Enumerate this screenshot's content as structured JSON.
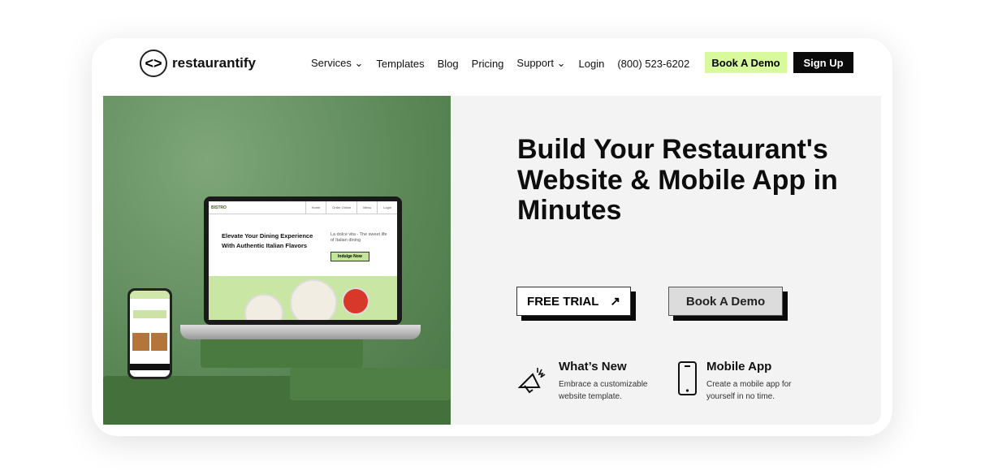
{
  "brand": {
    "name": "restaurantify"
  },
  "nav": {
    "items": [
      {
        "label": "Services",
        "dropdown": true
      },
      {
        "label": "Templates"
      },
      {
        "label": "Blog"
      },
      {
        "label": "Pricing"
      },
      {
        "label": "Support",
        "dropdown": true
      },
      {
        "label": "Login"
      },
      {
        "label": "(800) 523-6202"
      }
    ],
    "book_demo": "Book A Demo",
    "sign_up": "Sign Up"
  },
  "laptop_preview": {
    "logo": "BISTRO",
    "nav": [
      "Home",
      "Order Online",
      "Menu",
      "Login"
    ],
    "headline": "Elevate Your Dining Experience With Authentic Italian Flavors",
    "subtext": "La dolce vita - The sweet life of Italian dining",
    "cta": "Indulge Now"
  },
  "hero": {
    "title": "Build Your Restaurant's Website & Mobile App in Minutes",
    "free_trial": "FREE TRIAL",
    "book_demo": "Book A Demo"
  },
  "features": [
    {
      "title": "What’s New",
      "desc": "Embrace a customizable website template.",
      "icon": "megaphone-icon"
    },
    {
      "title": "Mobile App",
      "desc": "Create a mobile app for yourself in no time.",
      "icon": "smartphone-icon"
    }
  ],
  "colors": {
    "accent": "#d9f99d",
    "dark": "#0a0a0a",
    "hero_green": "#5b8757"
  }
}
